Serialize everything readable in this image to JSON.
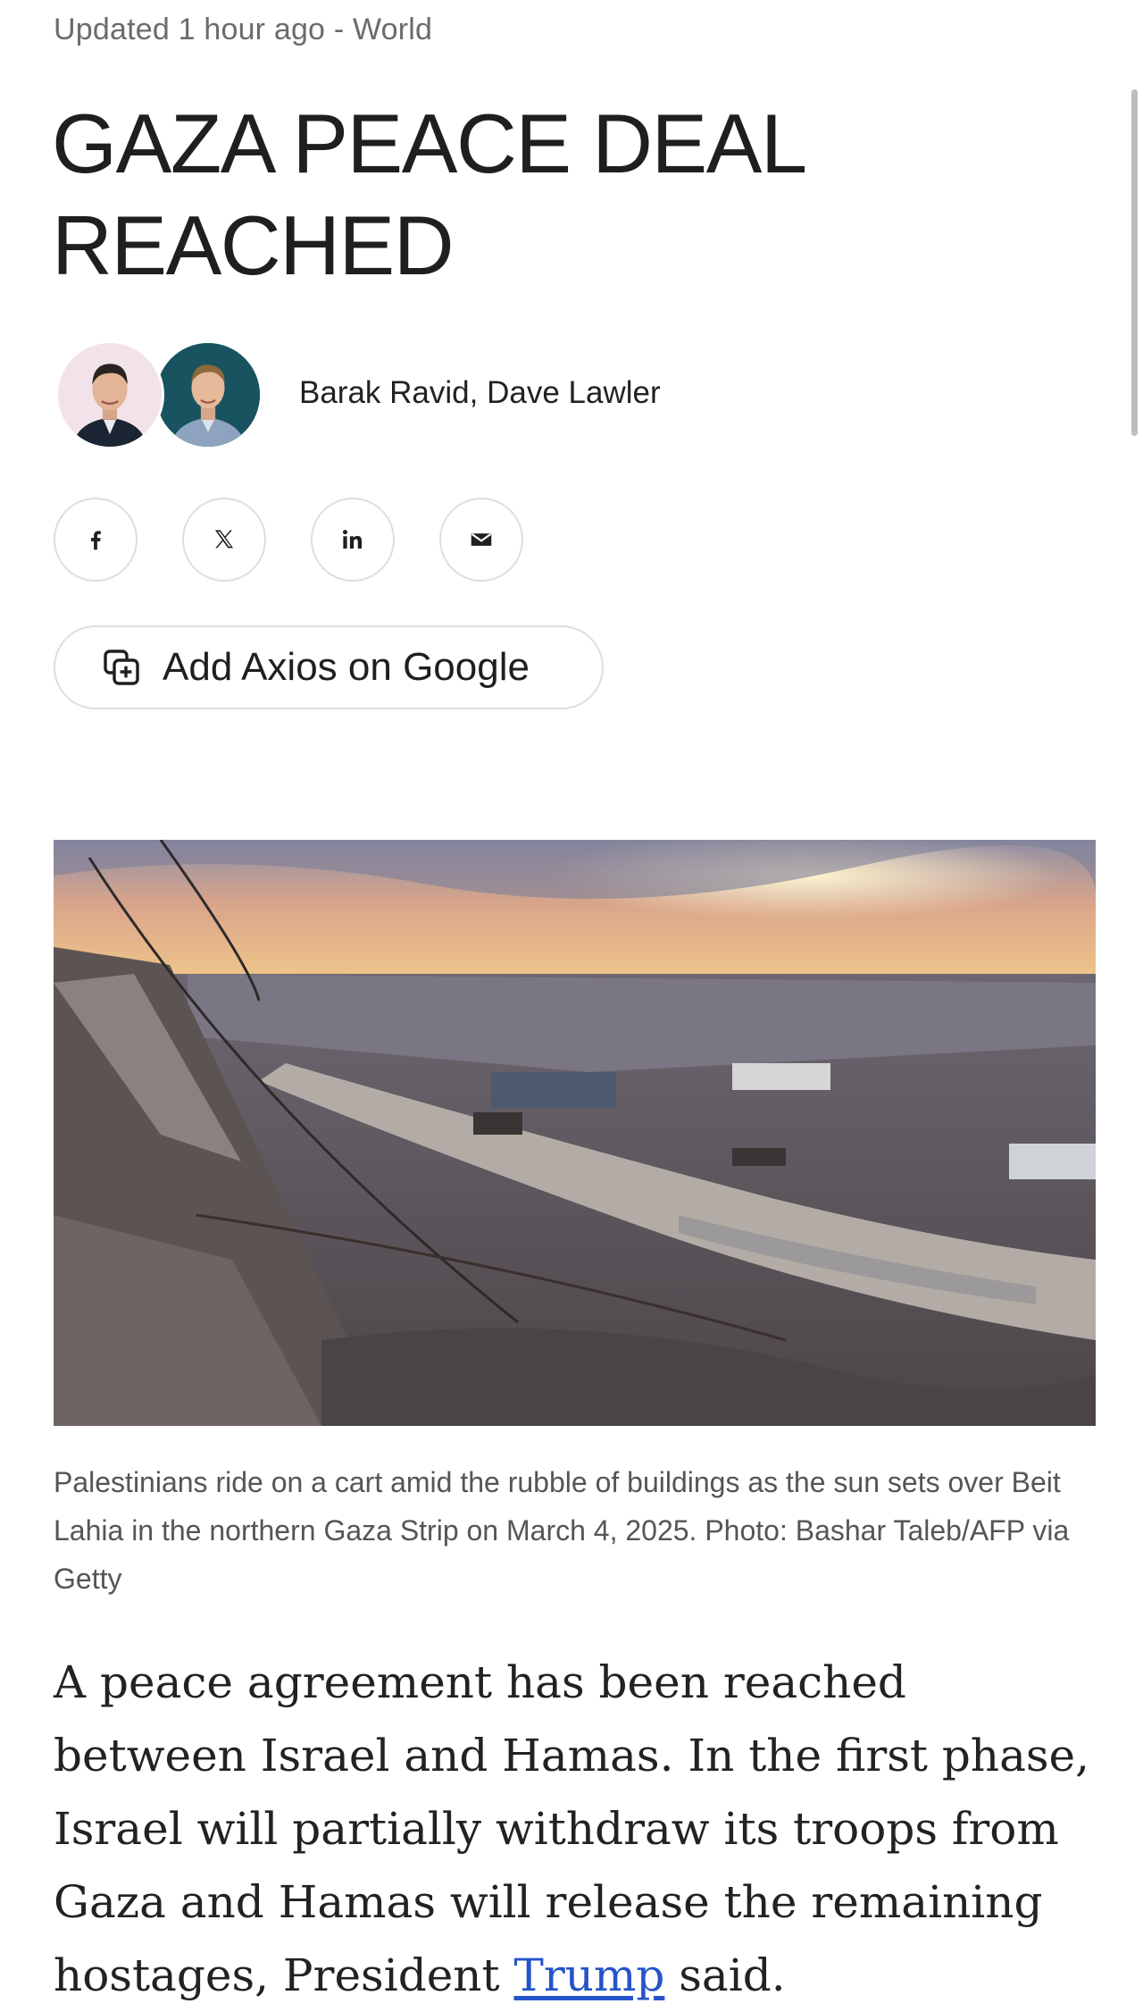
{
  "article": {
    "meta": "Updated 1 hour ago - World",
    "headline": "GAZA PEACE DEAL REACHED",
    "authors": "Barak Ravid, Dave Lawler",
    "caption": "Palestinians ride on a cart amid the rubble of buildings as the sun sets over Beit Lahia in the northern Gaza Strip on March 4, 2025. Photo: Bashar Taleb/AFP via Getty",
    "body": {
      "before_link": "A peace agreement has been reached between Israel and Hamas. In the first phase, Israel will partially withdraw its troops from Gaza and Hamas will release the remaining hostages, President ",
      "link_text": "Trump",
      "after_link": " said."
    }
  },
  "share": {
    "buttons": [
      {
        "icon": "facebook-icon"
      },
      {
        "icon": "x-icon"
      },
      {
        "icon": "linkedin-icon"
      },
      {
        "icon": "email-icon"
      }
    ],
    "google_label": "Add Axios on Google",
    "google_icon": "add-source-icon"
  },
  "colors": {
    "link": "#2553c9",
    "text": "#222222",
    "muted": "#6b6b6b",
    "border": "#dedede"
  }
}
